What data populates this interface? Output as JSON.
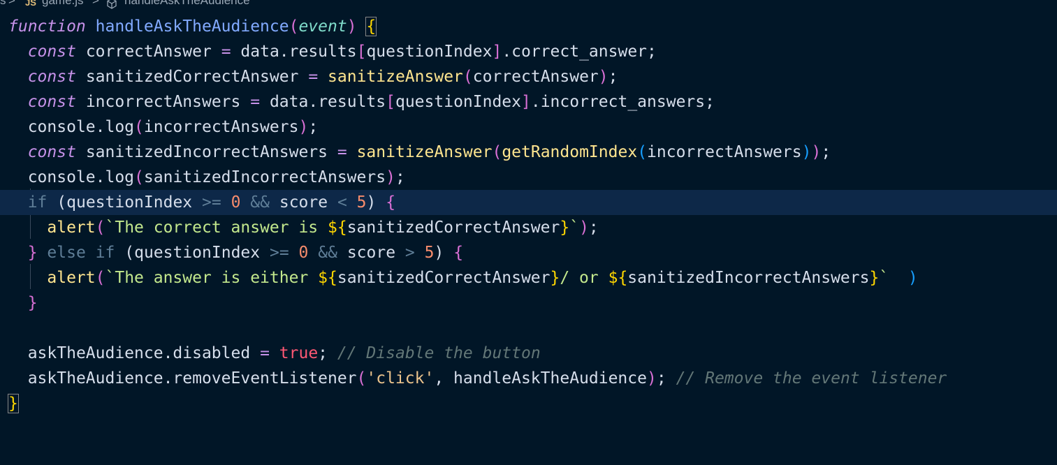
{
  "breadcrumb": {
    "folder": "s",
    "sep": ">",
    "lang_badge": "JS",
    "file": "game.js",
    "symbol": "handleAskTheAudience"
  },
  "code": {
    "l1": {
      "kw": "function",
      "name": "handleAskTheAudience",
      "lp": "(",
      "param": "event",
      "rp": ")",
      "lb": "{"
    },
    "l2": {
      "kw": "const",
      "a": "correctAnswer",
      "eq": "=",
      "b": "data.results",
      "lb": "[",
      "c": "questionIndex",
      "rb": "]",
      "d": ".correct_answer;"
    },
    "l3": {
      "kw": "const",
      "a": "sanitizedCorrectAnswer",
      "eq": "=",
      "fn": "sanitizeAnswer",
      "lp": "(",
      "arg": "correctAnswer",
      "rp": ")",
      "end": ";"
    },
    "l4": {
      "kw": "const",
      "a": "incorrectAnswers",
      "eq": "=",
      "b": "data.results",
      "lb": "[",
      "c": "questionIndex",
      "rb": "]",
      "d": ".incorrect_answers;"
    },
    "l5": {
      "a": "console.log",
      "lp": "(",
      "arg": "incorrectAnswers",
      "rp": ")",
      "end": ";"
    },
    "l6": {
      "kw": "const",
      "a": "sanitizedIncorrectAnswers",
      "eq": "=",
      "fn1": "sanitizeAnswer",
      "lp1": "(",
      "fn2": "getRandomIndex",
      "lp2": "(",
      "arg": "incorrectAnswers",
      "rp2": ")",
      "rp1": ")",
      "end": ";"
    },
    "l7": {
      "a": "console.log",
      "lp": "(",
      "arg": "sanitizedIncorrectAnswers",
      "rp": ")",
      "end": ";"
    },
    "l8": {
      "kw": "if",
      "lp": "(",
      "a": "questionIndex",
      "op1": ">=",
      "n1": "0",
      "op2": "&&",
      "b": "score",
      "op3": "<",
      "n2": "5",
      "rp": ")",
      "lb": "{"
    },
    "l9": {
      "fn": "alert",
      "lp": "(",
      "t1": "`The correct answer is ",
      "i1": "${",
      "v1": "sanitizedCorrectAnswer",
      "i2": "}",
      "t2": "`",
      "rp": ")",
      "end": ";"
    },
    "l10": {
      "rb": "}",
      "kw1": "else",
      "kw2": "if",
      "lp": "(",
      "a": "questionIndex",
      "op1": ">=",
      "n1": "0",
      "op2": "&&",
      "b": "score",
      "op3": ">",
      "n2": "5",
      "rp": ")",
      "lb": "{"
    },
    "l11": {
      "fn": "alert",
      "lp": "(",
      "t1": "`The answer is either ",
      "i1": "${",
      "v1": "sanitizedCorrectAnswer",
      "i2": "}",
      "t2": "/ or ",
      "i3": "${",
      "v2": "sanitizedIncorrectAnswers",
      "i4": "}",
      "t3": "`",
      "rp": ")"
    },
    "l12": {
      "rb": "}"
    },
    "l14": {
      "a": "askTheAudience.disabled",
      "eq": "=",
      "bool": "true",
      "end": ";",
      "cmt": "// Disable the button"
    },
    "l15": {
      "a": "askTheAudience.removeEventListener",
      "lp": "(",
      "str": "'click'",
      "comma": ",",
      "arg": "handleAskTheAudience",
      "rp": ")",
      "end": ";",
      "cmt": "// Remove the event listener"
    },
    "l16": {
      "rb": "}"
    }
  },
  "colors": {
    "background": "#011627",
    "current_line": "#0d2848",
    "keyword": "#c792ea",
    "function": "#ffe58f",
    "string": "#ecc48d",
    "template": "#c3e88d",
    "comment": "#637777",
    "number": "#f78c6c",
    "boolean": "#ff5874"
  }
}
